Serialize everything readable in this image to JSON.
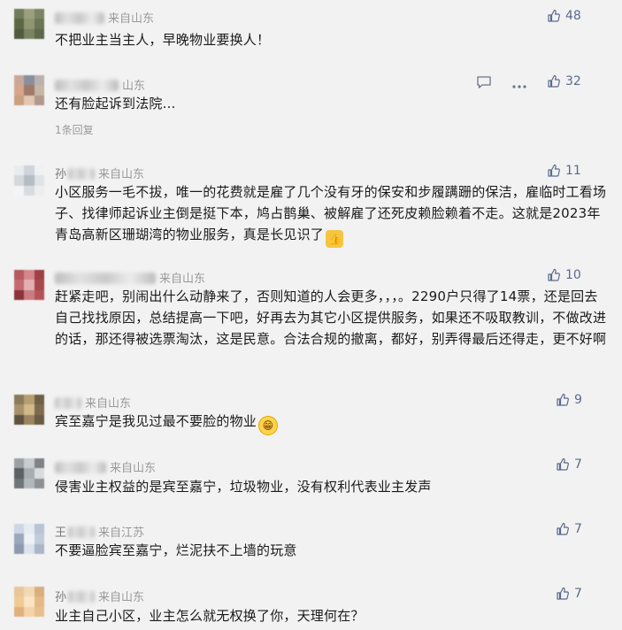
{
  "comments": [
    {
      "id": 1,
      "location": "来自山东",
      "likes": "48",
      "text": "不把业主当主人，早晚物业要换人！"
    },
    {
      "id": 2,
      "location": "山东",
      "likes": "32",
      "text": "还有脸起诉到法院...",
      "replies": "1条回复"
    },
    {
      "id": 3,
      "name_visible": "孙",
      "location": "来自山东",
      "likes": "11",
      "text": "小区服务一毛不拔，唯一的花费就是雇了几个没有牙的保安和步履蹒跚的保洁，雇临时工看场子、找律师起诉业主倒是挺下本，鸠占鹊巢、被解雇了还死皮赖脸赖着不走。这就是2023年青岛高新区珊瑚湾的物业服务，真是长见识了"
    },
    {
      "id": 4,
      "location": "来自山东",
      "likes": "10",
      "text": "赶紧走吧，别闹出什么动静来了，否则知道的人会更多，，，。2290户只得了14票，还是回去自己找找原因，总结提高一下吧，好再去为其它小区提供服务，如果还不吸取教训，不做改进的话，那还得被选票淘汰，这是民意。合法合规的撤离，都好，别弄得最后还得走，更不好啊"
    },
    {
      "id": 5,
      "location": "来自山东",
      "likes": "9",
      "text": "宾至嘉宁是我见过最不要脸的物业"
    },
    {
      "id": 6,
      "location": "来自山东",
      "likes": "7",
      "text": "侵害业主权益的是宾至嘉宁，垃圾物业，没有权利代表业主发声"
    },
    {
      "id": 7,
      "name_visible": "王",
      "location": "来自江苏",
      "likes": "7",
      "text": "不要逼脸宾至嘉宁，烂泥扶不上墙的玩意"
    },
    {
      "id": 8,
      "name_visible": "孙",
      "location": "来自山东",
      "likes": "7",
      "text": "业主自己小区，业主怎么就无权换了你，天理何在？"
    }
  ],
  "icons": {
    "like": "thumb-up-icon",
    "reply": "comment-icon",
    "more": "more-icon"
  },
  "colors": {
    "background": "#f2f2f2",
    "meta": "#999999",
    "like": "#5a6a8c",
    "text": "#1a1a1a"
  }
}
